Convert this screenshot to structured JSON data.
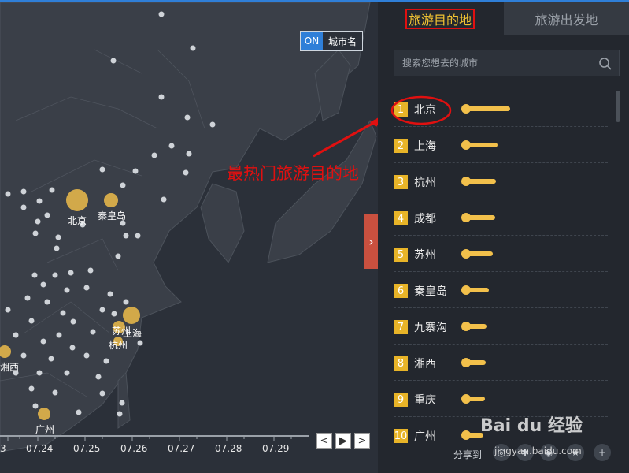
{
  "map": {
    "toggle_on": "ON",
    "toggle_label": "城市名",
    "city_labels": [
      "北京",
      "秦皇岛",
      "苏州",
      "上海",
      "杭州",
      "湘西",
      "广州"
    ],
    "annotation": "最热门旅游目的地",
    "timeline_dates": [
      "3",
      "07.24",
      "07.25",
      "07.26",
      "07.27",
      "07.28",
      "07.29"
    ],
    "prev_label": "<",
    "play_label": "▶",
    "next_label": ">",
    "collapse_label": "›"
  },
  "panel": {
    "tab_active": "旅游目的地",
    "tab_inactive": "旅游出发地",
    "search_placeholder": "搜索您想去的城市",
    "rankings": [
      {
        "rank": "1",
        "city": "北京",
        "level": 1.0
      },
      {
        "rank": "2",
        "city": "上海",
        "level": 0.72
      },
      {
        "rank": "3",
        "city": "杭州",
        "level": 0.68
      },
      {
        "rank": "4",
        "city": "成都",
        "level": 0.66
      },
      {
        "rank": "5",
        "city": "苏州",
        "level": 0.61
      },
      {
        "rank": "6",
        "city": "秦皇岛",
        "level": 0.52
      },
      {
        "rank": "7",
        "city": "九寨沟",
        "level": 0.47
      },
      {
        "rank": "8",
        "city": "湘西",
        "level": 0.45
      },
      {
        "rank": "9",
        "city": "重庆",
        "level": 0.42
      },
      {
        "rank": "10",
        "city": "广州",
        "level": 0.4
      }
    ],
    "share_label": "分享到",
    "watermark": "Bai du 经验",
    "watermark_url": "jingyan.baidu.com",
    "accent_color": "#f2c04b",
    "annotation_color": "#e01010"
  }
}
